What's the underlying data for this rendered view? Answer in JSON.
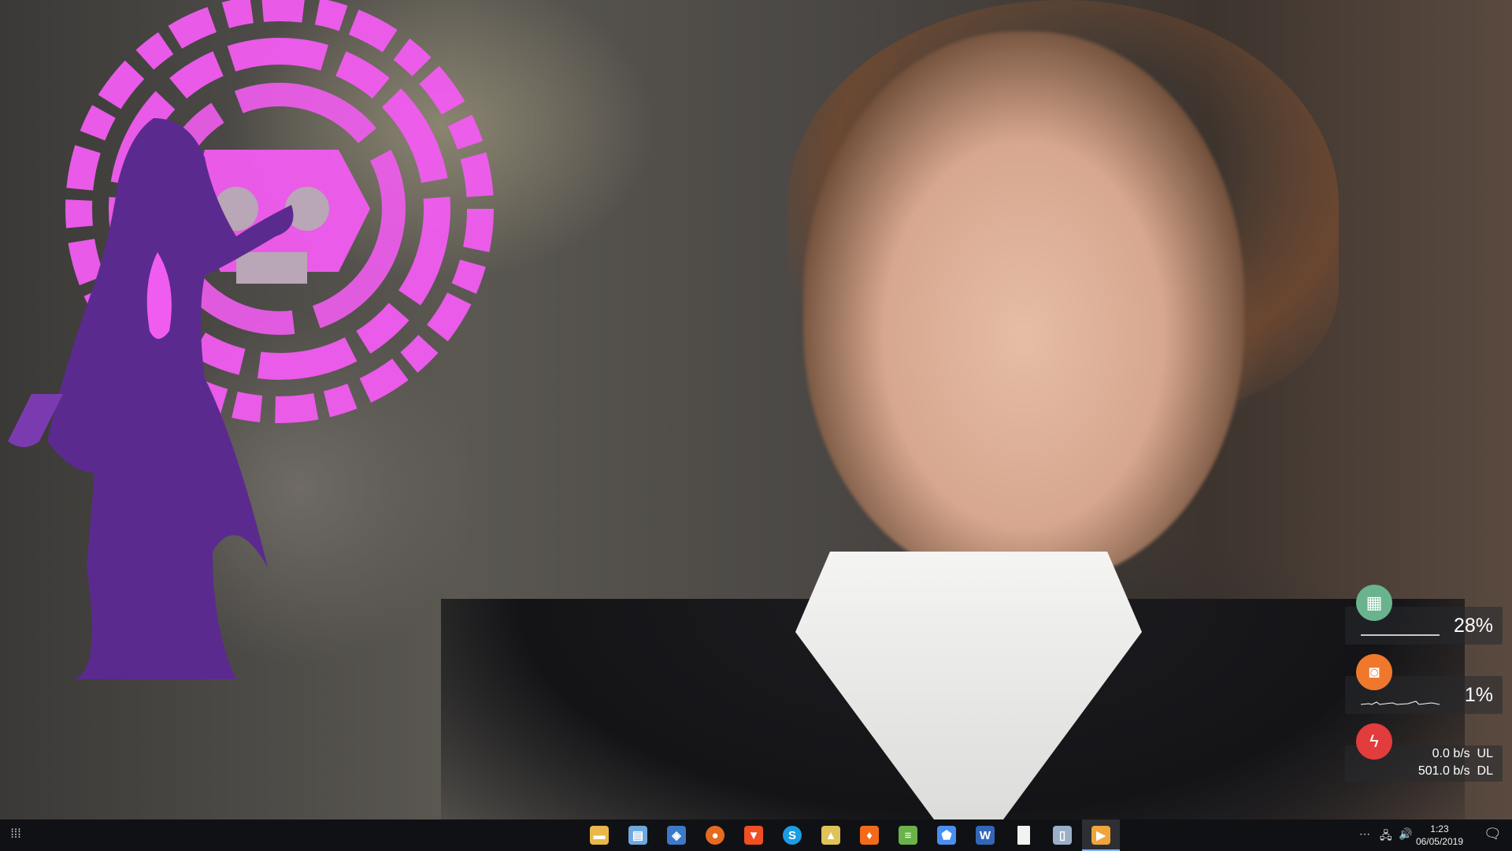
{
  "widgets": {
    "ram": {
      "icon": "ram-chip-icon",
      "color": "#69b48f",
      "value": "28%",
      "usage_fraction": 0.28
    },
    "cpu": {
      "icon": "cpu-icon",
      "color": "#f0782d",
      "value": "1%",
      "usage_fraction": 0.01
    },
    "network": {
      "icon": "lightning-icon",
      "color": "#e23c3c",
      "upload": "0.0 b/s",
      "upload_label": "UL",
      "download": "501.0 b/s",
      "download_label": "DL"
    }
  },
  "taskbar": {
    "start_icon": "start-grid-icon",
    "apps": [
      {
        "name": "file-explorer",
        "icon": "folder-icon",
        "color": "#e8b84a"
      },
      {
        "name": "notepad-tool",
        "icon": "notebook-icon",
        "color": "#6fa8dc"
      },
      {
        "name": "virtualbox",
        "icon": "cube-icon",
        "color": "#3c79c8"
      },
      {
        "name": "firefox",
        "icon": "firefox-icon",
        "color": "#e66a1f"
      },
      {
        "name": "brave",
        "icon": "brave-lion-icon",
        "color": "#f04e23"
      },
      {
        "name": "skype",
        "icon": "skype-icon",
        "color": "#1b9de2"
      },
      {
        "name": "image-viewer",
        "icon": "picture-icon",
        "color": "#e0c25a"
      },
      {
        "name": "fire-app",
        "icon": "flame-icon",
        "color": "#f26a1a"
      },
      {
        "name": "book-app",
        "icon": "book-stack-icon",
        "color": "#6ab24a"
      },
      {
        "name": "shape-app",
        "icon": "polygon-icon",
        "color": "#4a8ef0"
      },
      {
        "name": "writer",
        "icon": "w-letter-icon",
        "color": "#3466b8"
      },
      {
        "name": "blank-doc",
        "icon": "document-icon",
        "color": "#f2f2f2"
      },
      {
        "name": "usb-app",
        "icon": "usb-drive-icon",
        "color": "#9ab0c8"
      },
      {
        "name": "media-player",
        "icon": "media-play-icon",
        "color": "#f0a43a"
      }
    ],
    "tray": {
      "overflow_icon": "ellipsis-icon",
      "network_icon": "network-icon",
      "volume_icon": "speaker-icon",
      "time": "1:23",
      "date": "06/05/2019",
      "notification_icon": "notification-icon"
    }
  },
  "colors": {
    "taskbar_bg": "#101114",
    "emblem_pink": "#f15cf0",
    "figure_purple": "#7a3bb0"
  }
}
